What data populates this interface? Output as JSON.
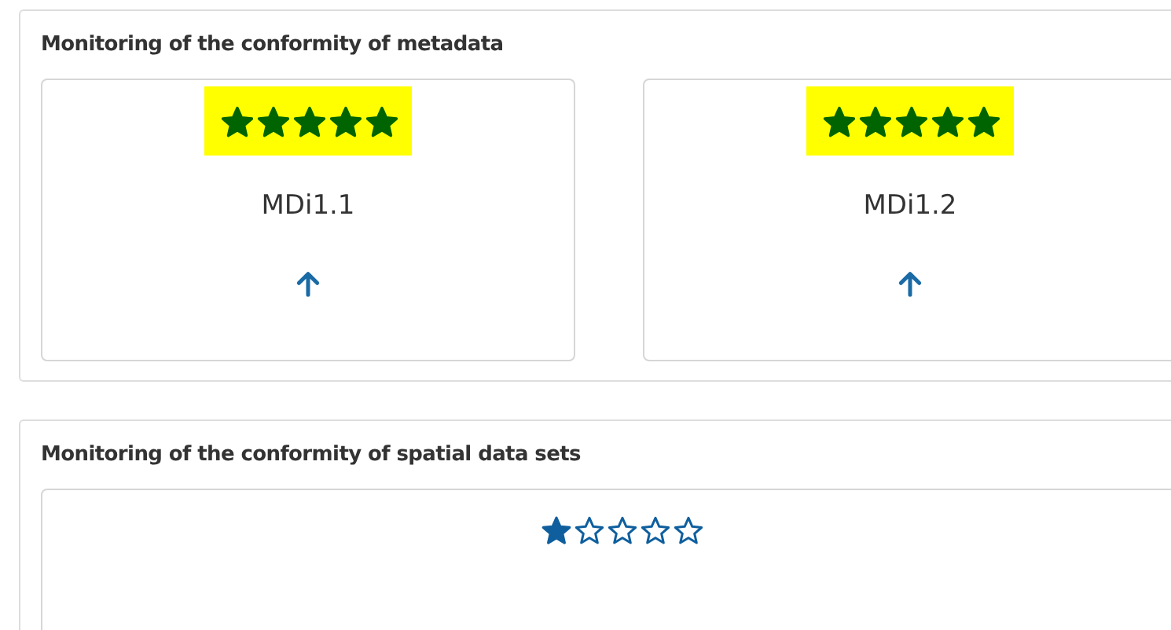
{
  "sections": [
    {
      "title": "Monitoring of the conformity of metadata",
      "cards": [
        {
          "stars": 5,
          "highlighted": true,
          "label": "MDi1.1",
          "arrow_up": true
        },
        {
          "stars": 5,
          "highlighted": true,
          "label": "MDi1.2",
          "arrow_up": true
        }
      ]
    },
    {
      "title": "Monitoring of the conformity of spatial data sets",
      "cards": [
        {
          "stars": 1,
          "highlighted": false
        }
      ]
    }
  ]
}
